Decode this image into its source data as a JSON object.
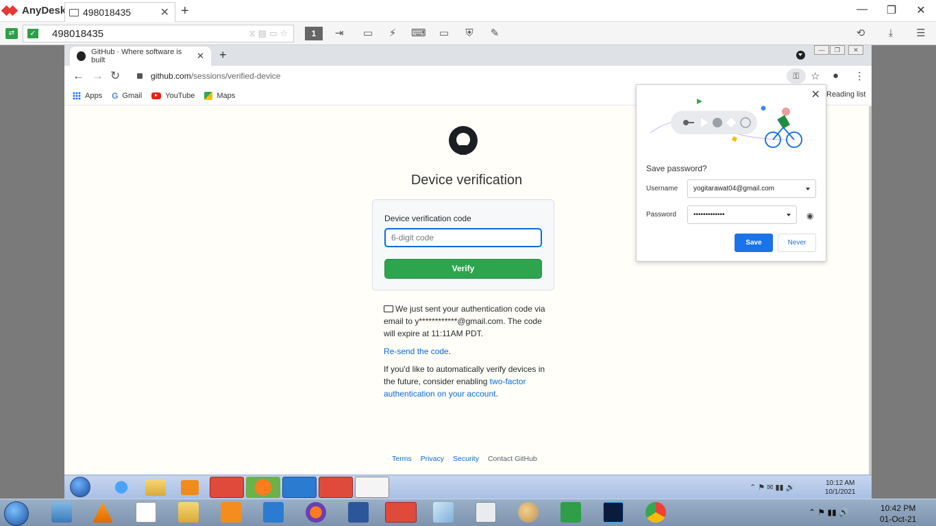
{
  "anydesk": {
    "app_name": "AnyDesk",
    "tab_label": "498018435",
    "address": "498018435",
    "monitor_number": "1"
  },
  "chrome": {
    "tab_title": "GitHub · Where software is built",
    "url_host": "github.com",
    "url_path": "/sessions/verified-device",
    "bookmarks": [
      "Apps",
      "Gmail",
      "YouTube",
      "Maps"
    ],
    "reading_list": "Reading list"
  },
  "page": {
    "heading": "Device verification",
    "code_label": "Device verification code",
    "code_placeholder": "6-digit code",
    "verify_label": "Verify",
    "info_line1": "We just sent your authentication code via email to y************@gmail.com. The code will expire at 11:11AM PDT.",
    "resend_link": "Re-send the code",
    "resend_suffix": ".",
    "twofa_prefix": "If you'd like to automatically verify devices in the future, consider enabling ",
    "twofa_link": "two-factor authentication on your account",
    "twofa_suffix": ".",
    "footer": [
      "Terms",
      "Privacy",
      "Security",
      "Contact GitHub"
    ]
  },
  "password_bubble": {
    "title": "Save password?",
    "username_label": "Username",
    "username_value": "yogitarawat04@gmail.com",
    "password_label": "Password",
    "password_value": "•••••••••••••",
    "save_label": "Save",
    "never_label": "Never"
  },
  "remote_clock": {
    "time": "10:12 AM",
    "date": "10/1/2021"
  },
  "host_clock": {
    "time": "10:42 PM",
    "date": "01-Oct-21"
  },
  "colors": {
    "accent_blue": "#1a73e8",
    "github_green": "#2da44e",
    "anydesk_red": "#e53935"
  }
}
